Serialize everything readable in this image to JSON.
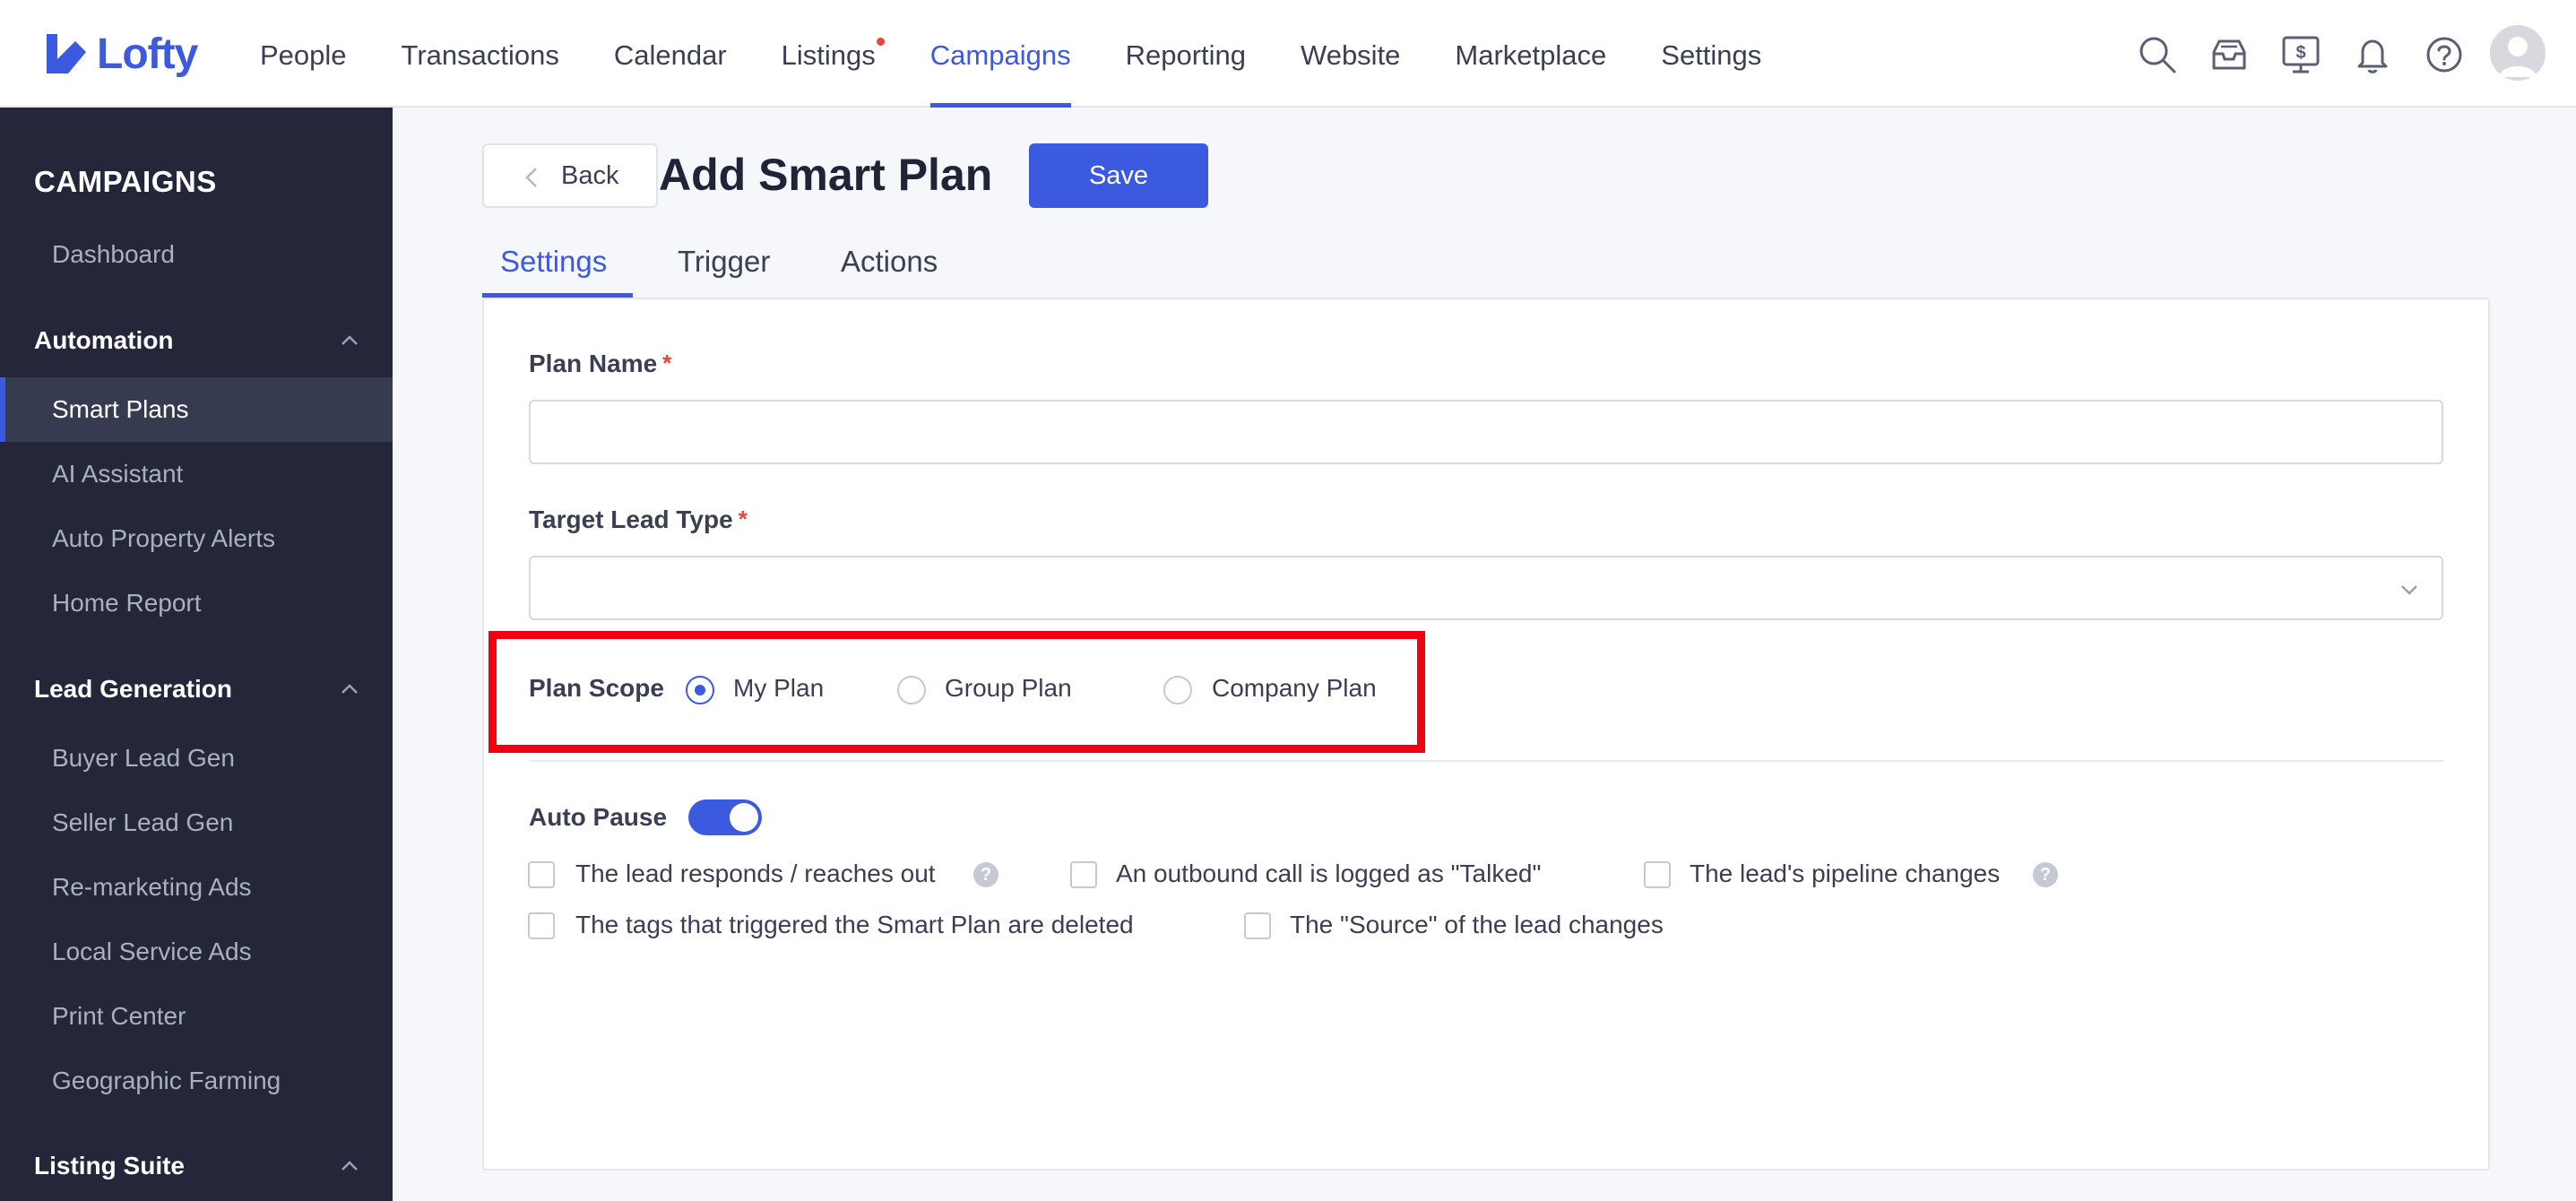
{
  "app": {
    "logo_text": "Lofty"
  },
  "topnav": {
    "items": [
      {
        "label": "People"
      },
      {
        "label": "Transactions"
      },
      {
        "label": "Calendar"
      },
      {
        "label": "Listings"
      },
      {
        "label": "Campaigns"
      },
      {
        "label": "Reporting"
      },
      {
        "label": "Website"
      },
      {
        "label": "Marketplace"
      },
      {
        "label": "Settings"
      }
    ],
    "active": "Campaigns",
    "icons": [
      "search-icon",
      "inbox-icon",
      "billing-icon",
      "bell-icon",
      "help-icon",
      "avatar"
    ]
  },
  "sidebar": {
    "title": "CAMPAIGNS",
    "dashboard": "Dashboard",
    "groups": [
      {
        "label": "Automation",
        "items": [
          "Smart Plans",
          "AI Assistant",
          "Auto Property Alerts",
          "Home Report"
        ]
      },
      {
        "label": "Lead Generation",
        "items": [
          "Buyer Lead Gen",
          "Seller Lead Gen",
          "Re-marketing Ads",
          "Local Service Ads",
          "Print Center",
          "Geographic Farming"
        ]
      },
      {
        "label": "Listing Suite",
        "items": []
      }
    ],
    "active_item": "Smart Plans"
  },
  "header": {
    "back_label": "Back",
    "title": "Add Smart Plan",
    "save_label": "Save"
  },
  "tabs": [
    {
      "label": "Settings"
    },
    {
      "label": "Trigger"
    },
    {
      "label": "Actions"
    }
  ],
  "form": {
    "plan_name": {
      "label": "Plan Name",
      "required_mark": "*",
      "value": ""
    },
    "target_lead_type": {
      "label": "Target Lead Type",
      "required_mark": "*",
      "value": ""
    },
    "plan_scope": {
      "label": "Plan Scope",
      "options": [
        "My Plan",
        "Group Plan",
        "Company Plan"
      ],
      "selected": "My Plan"
    },
    "auto_pause": {
      "label": "Auto Pause",
      "enabled": true,
      "conditions": [
        {
          "label": "The lead responds / reaches out",
          "checked": false,
          "help": true
        },
        {
          "label": "An outbound call is logged as \"Talked\"",
          "checked": false,
          "help": false
        },
        {
          "label": "The lead's pipeline changes",
          "checked": false,
          "help": true
        },
        {
          "label": "The tags that triggered the Smart Plan are deleted",
          "checked": false,
          "help": false
        },
        {
          "label": "The \"Source\" of the lead changes",
          "checked": false,
          "help": false
        }
      ],
      "help_glyph": "?"
    }
  },
  "colors": {
    "accent": "#3c5ae0",
    "sidebar_bg": "#232739",
    "highlight": "#f00011"
  }
}
